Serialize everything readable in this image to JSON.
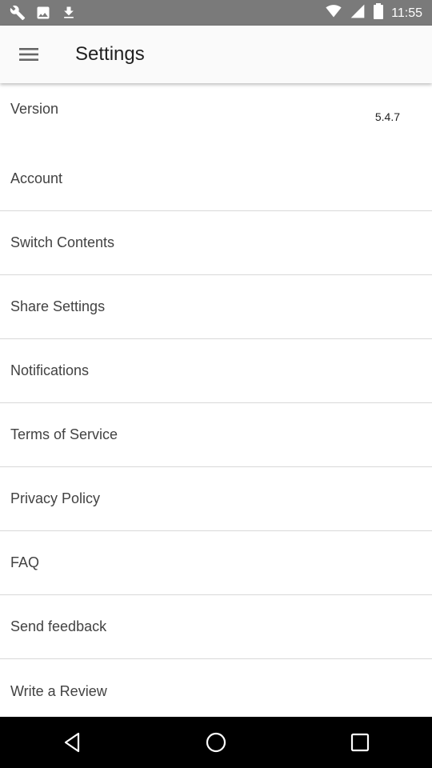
{
  "status_bar": {
    "time": "11:55"
  },
  "app_bar": {
    "title": "Settings"
  },
  "version": {
    "label": "Version",
    "value": "5.4.7"
  },
  "items": [
    {
      "label": "Account"
    },
    {
      "label": "Switch Contents"
    },
    {
      "label": "Share Settings"
    },
    {
      "label": "Notifications"
    },
    {
      "label": "Terms of Service"
    },
    {
      "label": "Privacy Policy"
    },
    {
      "label": "FAQ"
    },
    {
      "label": "Send feedback"
    },
    {
      "label": "Write a Review"
    }
  ],
  "icons": {
    "status_left": [
      "wrench-icon",
      "image-icon",
      "download-icon"
    ],
    "status_right": [
      "wifi-icon",
      "signal-icon",
      "battery-icon"
    ],
    "menu": "hamburger-menu-icon",
    "nav": [
      "back-icon",
      "home-icon",
      "recents-icon"
    ]
  },
  "colors": {
    "status_bar": "#7a7a7a",
    "app_bar": "#fafafa",
    "nav_bar": "#000000"
  }
}
